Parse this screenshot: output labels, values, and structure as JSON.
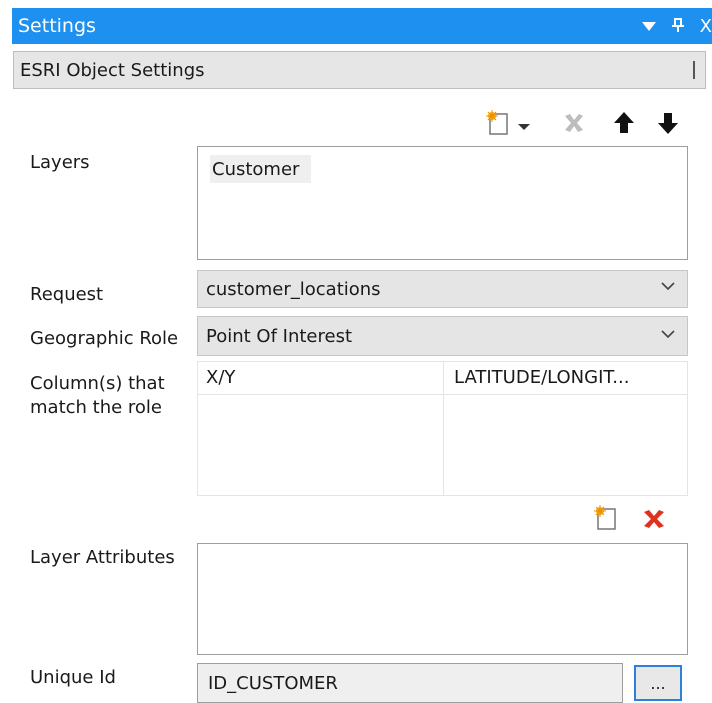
{
  "panel": {
    "title": "Settings",
    "title_icons": [
      "dropdown-arrow-icon",
      "pin-icon",
      "close-icon"
    ],
    "close_glyph": "X",
    "section_header": "ESRI Object Settings"
  },
  "layers": {
    "label": "Layers",
    "items": [
      "Customer"
    ],
    "toolbar_icons": [
      "new-layer-icon",
      "dropdown-arrow-icon",
      "delete-layer-icon",
      "move-up-icon",
      "move-down-icon"
    ]
  },
  "request": {
    "label": "Request",
    "value": "customer_locations"
  },
  "geographic_role": {
    "label": "Geographic Role",
    "value": "Point Of Interest"
  },
  "role_columns": {
    "label_line1": "Column(s) that",
    "label_line2": "match the role",
    "columns": [
      "X/Y",
      "LATITUDE/LONGIT..."
    ]
  },
  "layer_attributes": {
    "label": "Layer Attributes",
    "toolbar_icons": [
      "new-attribute-icon",
      "delete-attribute-icon"
    ]
  },
  "unique_id": {
    "label": "Unique Id",
    "value": "ID_CUSTOMER",
    "browse_label": "..."
  },
  "colors": {
    "titlebar": "#1e90f0",
    "delete_red": "#e0301e",
    "focus_blue": "#2a82da"
  }
}
